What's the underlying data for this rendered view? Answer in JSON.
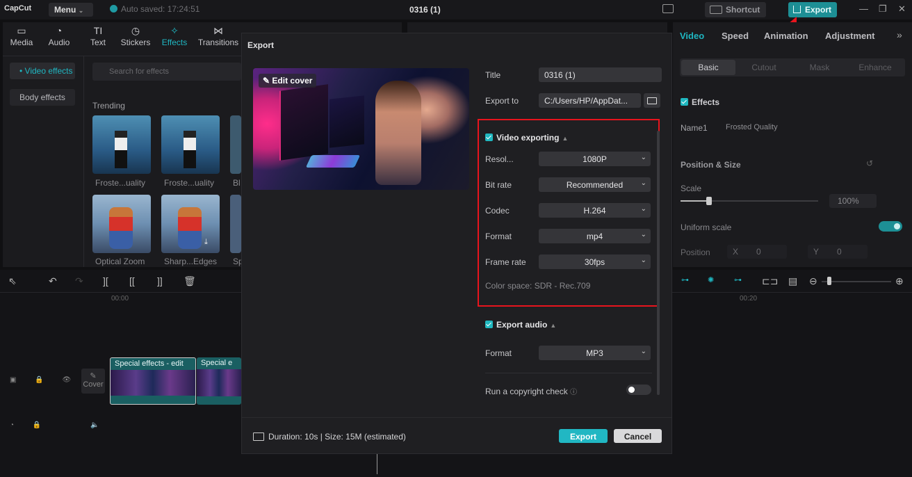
{
  "app": {
    "logo": "CapCut",
    "menu": "Menu",
    "autosave": "Auto saved: 17:24:51",
    "project_title": "0316 (1)",
    "shortcut": "Shortcut",
    "export": "Export"
  },
  "toolbar": {
    "tabs": [
      {
        "label": "Media",
        "icon": "media-icon"
      },
      {
        "label": "Audio",
        "icon": "audio-icon"
      },
      {
        "label": "Text",
        "icon": "text-icon"
      },
      {
        "label": "Stickers",
        "icon": "stickers-icon"
      },
      {
        "label": "Effects",
        "icon": "effects-icon",
        "active": true
      },
      {
        "label": "Transitions",
        "icon": "transitions-icon"
      }
    ]
  },
  "effects_panel": {
    "side": [
      "• Video effects",
      "Body effects"
    ],
    "search_placeholder": "Search for effects",
    "section": "Trending",
    "items": [
      "Froste...uality",
      "Froste...uality",
      "Bl",
      "Optical Zoom",
      "Sharp...Edges",
      "Sp"
    ]
  },
  "right_panel": {
    "tabs": [
      "Video",
      "Speed",
      "Animation",
      "Adjustment"
    ],
    "subtabs": [
      "Basic",
      "Cutout",
      "Mask",
      "Enhance"
    ],
    "effects_title": "Effects",
    "name_label": "Name1",
    "name_value": "Frosted Quality",
    "pos_size": "Position & Size",
    "scale_label": "Scale",
    "scale_value": "100%",
    "uniform_scale": "Uniform scale",
    "position_label": "Position",
    "x_label": "X",
    "x_value": "0",
    "y_label": "Y",
    "y_value": "0"
  },
  "timeline": {
    "time_start": "00:00",
    "time_right": "00:20",
    "cover_label": "Cover",
    "clip1": "Special effects - edit",
    "clip2": "Special e"
  },
  "export_dialog": {
    "title": "Export",
    "edit_cover": "Edit cover",
    "title_label": "Title",
    "title_value": "0316 (1)",
    "export_to_label": "Export to",
    "export_to_value": "C:/Users/HP/AppDat...",
    "video_section": "Video exporting",
    "resolution_label": "Resol...",
    "resolution_value": "1080P",
    "bitrate_label": "Bit rate",
    "bitrate_value": "Recommended",
    "codec_label": "Codec",
    "codec_value": "H.264",
    "format_label": "Format",
    "format_value": "mp4",
    "framerate_label": "Frame rate",
    "framerate_value": "30fps",
    "color_space": "Color space: SDR - Rec.709",
    "audio_section": "Export audio",
    "audio_format_label": "Format",
    "audio_format_value": "MP3",
    "copyright_label": "Run a copyright check",
    "duration": "Duration: 10s | Size: 15M (estimated)",
    "export_btn": "Export",
    "cancel_btn": "Cancel"
  },
  "colors": {
    "accent": "#21b7c3",
    "highlight": "#e8141d"
  }
}
